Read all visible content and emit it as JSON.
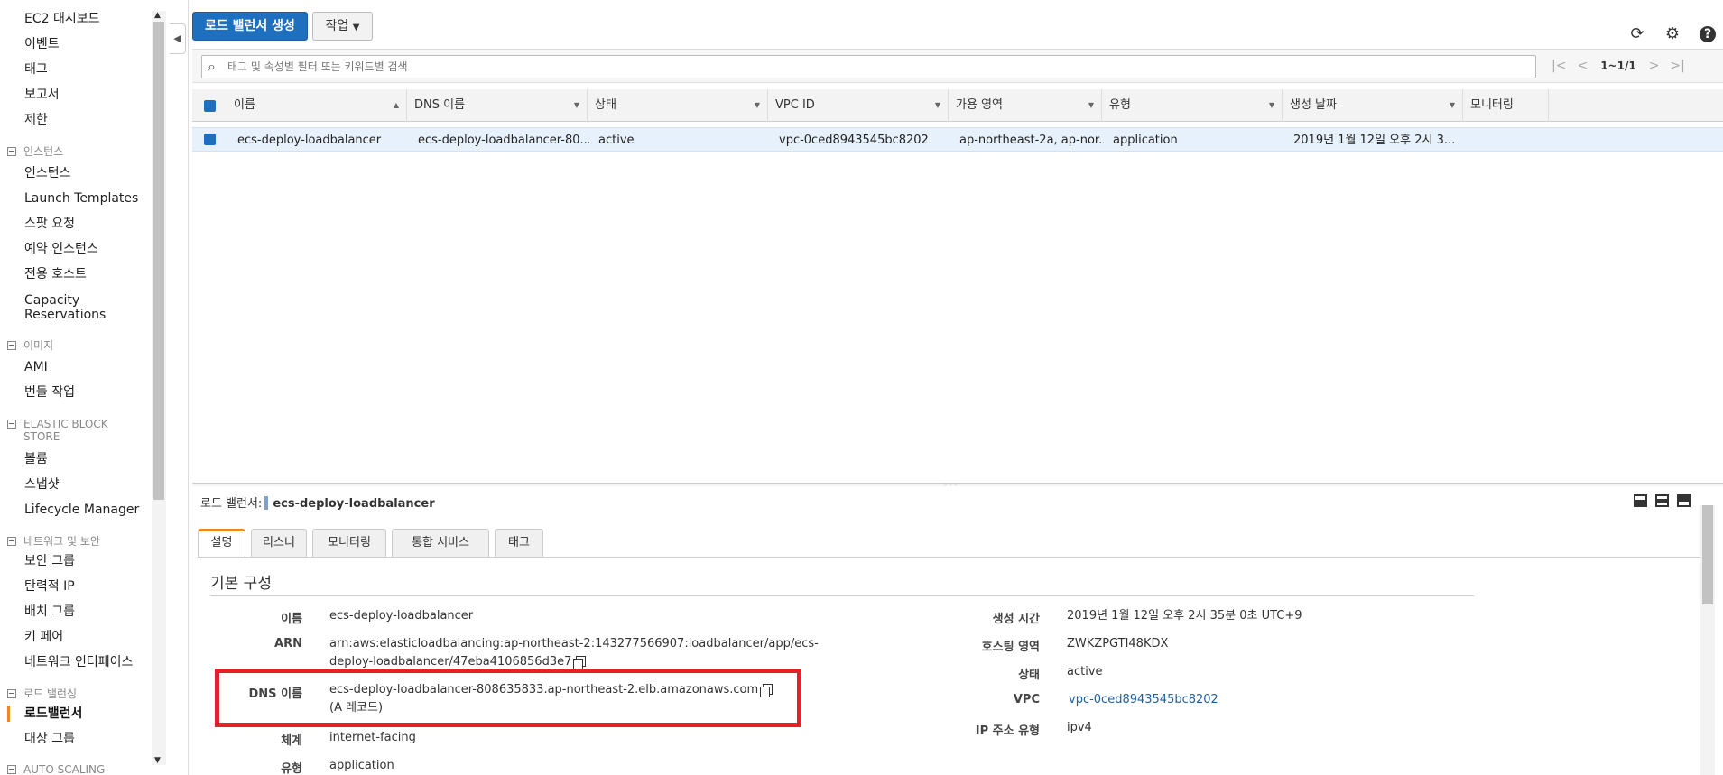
{
  "sidebar": {
    "items": [
      {
        "label": "EC2 대시보드"
      },
      {
        "label": "이벤트"
      },
      {
        "label": "태그"
      },
      {
        "label": "보고서"
      },
      {
        "label": "제한"
      }
    ],
    "sections": [
      {
        "title": "인스턴스",
        "items": [
          "인스턴스",
          "Launch Templates",
          "스팟 요청",
          "예약 인스턴스",
          "전용 호스트",
          "Capacity Reservations"
        ]
      },
      {
        "title": "이미지",
        "items": [
          "AMI",
          "번들 작업"
        ]
      },
      {
        "title": "ELASTIC BLOCK STORE",
        "items": [
          "볼륨",
          "스냅샷",
          "Lifecycle Manager"
        ]
      },
      {
        "title": "네트워크 및 보안",
        "items": [
          "보안 그룹",
          "탄력적 IP",
          "배치 그룹",
          "키 페어",
          "네트워크 인터페이스"
        ]
      },
      {
        "title": "로드 밸런싱",
        "items": [
          "로드밸런서",
          "대상 그룹"
        ]
      },
      {
        "title": "AUTO SCALING",
        "items": []
      }
    ],
    "active_item": "로드밸런서"
  },
  "toolbar": {
    "create_label": "로드 밸런서 생성",
    "action_label": "작업",
    "refresh_icon": "refresh-icon",
    "settings_icon": "gear-icon",
    "help_label": "?"
  },
  "search": {
    "placeholder": "태그 및 속성별 필터 또는 키워드별 검색",
    "value": ""
  },
  "pager": {
    "count": "1~1/1"
  },
  "table": {
    "columns": [
      "이름",
      "DNS 이름",
      "상태",
      "VPC ID",
      "가용 영역",
      "유형",
      "생성 날짜",
      "모니터링"
    ],
    "rows": [
      {
        "name": "ecs-deploy-loadbalancer",
        "dns": "ecs-deploy-loadbalancer-80...",
        "state": "active",
        "vpc": "vpc-0ced8943545bc8202",
        "az": "ap-northeast-2a, ap-nor...",
        "type": "application",
        "created": "2019년 1월 12일 오후 2시 3...",
        "monitoring": ""
      }
    ]
  },
  "detail": {
    "header_label": "로드 밸런서:",
    "header_name": "ecs-deploy-loadbalancer",
    "tabs": [
      "설명",
      "리스너",
      "모니터링",
      "통합 서비스",
      "태그"
    ],
    "active_tab": "설명",
    "section_title": "기본 구성",
    "left": {
      "name_label": "이름",
      "name_value": "ecs-deploy-loadbalancer",
      "arn_label": "ARN",
      "arn_line1": "arn:aws:elasticloadbalancing:ap-northeast-2:143277566907:loadbalancer/app/ecs-",
      "arn_line2": "deploy-loadbalancer/47eba4106856d3e7",
      "dns_label": "DNS 이름",
      "dns_line1": "ecs-deploy-loadbalancer-808635833.ap-northeast-2.elb.amazonaws.com",
      "dns_line2": "(A 레코드)",
      "scheme_label": "체계",
      "scheme_value": "internet-facing",
      "type_label": "유형",
      "type_value": "application"
    },
    "right": {
      "created_label": "생성 시간",
      "created_value": "2019년 1월 12일 오후 2시 35분 0초 UTC+9",
      "zone_label": "호스팅 영역",
      "zone_value": "ZWKZPGTI48KDX",
      "state_label": "상태",
      "state_value": "active",
      "vpc_label": "VPC",
      "vpc_value": "vpc-0ced8943545bc8202",
      "ip_label": "IP 주소 유형",
      "ip_value": "ipv4"
    }
  },
  "colors": {
    "primary": "#1f6fbf",
    "accent": "#eb8a1f",
    "highlight": "#e3202b",
    "row_selected": "#e7f1fb"
  }
}
